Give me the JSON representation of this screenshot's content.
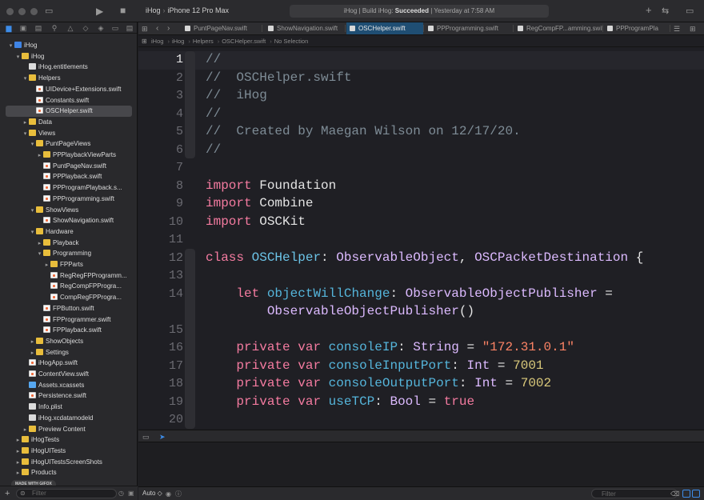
{
  "toolbar": {
    "scheme": "iHog",
    "destination": "iPhone 12 Pro Max",
    "status_prefix": "iHog | Build iHog: ",
    "status_result": "Succeeded",
    "status_suffix": " | Yesterday at 7:58 AM"
  },
  "tabs": [
    {
      "label": "PuntPageNav.swift",
      "active": false
    },
    {
      "label": "ShowNavigation.swift",
      "active": false
    },
    {
      "label": "OSCHelper.swift",
      "active": true
    },
    {
      "label": "PPProgramming.swift",
      "active": false
    },
    {
      "label": "RegCompFP...amming.swift",
      "active": false
    },
    {
      "label": "PPProgramPla",
      "active": false
    }
  ],
  "breadcrumbs": [
    "iHog",
    "iHog",
    "Helpers",
    "OSCHelper.swift",
    "No Selection"
  ],
  "navigator": {
    "items": [
      {
        "label": "iHog",
        "icon": "proj",
        "depth": 0,
        "disc": "▾"
      },
      {
        "label": "iHog",
        "icon": "folder",
        "depth": 1,
        "disc": "▾"
      },
      {
        "label": "iHog.entitlements",
        "icon": "file",
        "depth": 2,
        "disc": ""
      },
      {
        "label": "Helpers",
        "icon": "folder",
        "depth": 2,
        "disc": "▾"
      },
      {
        "label": "UIDevice+Extensions.swift",
        "icon": "swift",
        "depth": 3,
        "disc": ""
      },
      {
        "label": "Constants.swift",
        "icon": "swift",
        "depth": 3,
        "disc": ""
      },
      {
        "label": "OSCHelper.swift",
        "icon": "swift",
        "depth": 3,
        "disc": "",
        "selected": true
      },
      {
        "label": "Data",
        "icon": "folder",
        "depth": 2,
        "disc": "▸"
      },
      {
        "label": "Views",
        "icon": "folder",
        "depth": 2,
        "disc": "▾"
      },
      {
        "label": "PuntPageViews",
        "icon": "folder",
        "depth": 3,
        "disc": "▾"
      },
      {
        "label": "PPPlaybackViewParts",
        "icon": "folder",
        "depth": 4,
        "disc": "▸"
      },
      {
        "label": "PuntPageNav.swift",
        "icon": "swift",
        "depth": 4,
        "disc": ""
      },
      {
        "label": "PPPlayback.swift",
        "icon": "swift",
        "depth": 4,
        "disc": ""
      },
      {
        "label": "PPProgramPlayback.s...",
        "icon": "swift",
        "depth": 4,
        "disc": ""
      },
      {
        "label": "PPProgramming.swift",
        "icon": "swift",
        "depth": 4,
        "disc": ""
      },
      {
        "label": "ShowViews",
        "icon": "folder",
        "depth": 3,
        "disc": "▾"
      },
      {
        "label": "ShowNavigation.swift",
        "icon": "swift",
        "depth": 4,
        "disc": ""
      },
      {
        "label": "Hardware",
        "icon": "folder",
        "depth": 3,
        "disc": "▾"
      },
      {
        "label": "Playback",
        "icon": "folder",
        "depth": 4,
        "disc": "▸"
      },
      {
        "label": "Programming",
        "icon": "folder",
        "depth": 4,
        "disc": "▾"
      },
      {
        "label": "FPParts",
        "icon": "folder",
        "depth": 5,
        "disc": "▸"
      },
      {
        "label": "RegRegFPProgramm...",
        "icon": "swift",
        "depth": 5,
        "disc": ""
      },
      {
        "label": "RegCompFPProgra...",
        "icon": "swift",
        "depth": 5,
        "disc": ""
      },
      {
        "label": "CompRegFPProgra...",
        "icon": "swift",
        "depth": 5,
        "disc": ""
      },
      {
        "label": "FPButton.swift",
        "icon": "swift",
        "depth": 4,
        "disc": ""
      },
      {
        "label": "FPProgrammer.swift",
        "icon": "swift",
        "depth": 4,
        "disc": ""
      },
      {
        "label": "FPPlayback.swift",
        "icon": "swift",
        "depth": 4,
        "disc": ""
      },
      {
        "label": "ShowObjects",
        "icon": "folder",
        "depth": 3,
        "disc": "▸"
      },
      {
        "label": "Settings",
        "icon": "folder",
        "depth": 3,
        "disc": "▸"
      },
      {
        "label": "iHogApp.swift",
        "icon": "swift",
        "depth": 2,
        "disc": ""
      },
      {
        "label": "ContentView.swift",
        "icon": "swift",
        "depth": 2,
        "disc": ""
      },
      {
        "label": "Assets.xcassets",
        "icon": "assets",
        "depth": 2,
        "disc": ""
      },
      {
        "label": "Persistence.swift",
        "icon": "swift",
        "depth": 2,
        "disc": ""
      },
      {
        "label": "Info.plist",
        "icon": "file",
        "depth": 2,
        "disc": ""
      },
      {
        "label": "iHog.xcdatamodeld",
        "icon": "data",
        "depth": 2,
        "disc": ""
      },
      {
        "label": "Preview Content",
        "icon": "folder",
        "depth": 2,
        "disc": "▸"
      },
      {
        "label": "iHogTests",
        "icon": "folder",
        "depth": 1,
        "disc": "▸"
      },
      {
        "label": "iHogUITests",
        "icon": "folder",
        "depth": 1,
        "disc": "▸"
      },
      {
        "label": "iHogUITestsScreenShots",
        "icon": "folder",
        "depth": 1,
        "disc": "▸"
      },
      {
        "label": "Products",
        "icon": "folder",
        "depth": 1,
        "disc": "▸"
      }
    ],
    "filter_placeholder": "Filter",
    "watermark": "MADE WITH GIFOX"
  },
  "editor": {
    "current_line": 1,
    "lines": [
      {
        "num": "1",
        "tokens": [
          [
            "//",
            "c-comment"
          ]
        ]
      },
      {
        "num": "2",
        "tokens": [
          [
            "//  OSCHelper.swift",
            "c-comment"
          ]
        ]
      },
      {
        "num": "3",
        "tokens": [
          [
            "//  iHog",
            "c-comment"
          ]
        ]
      },
      {
        "num": "4",
        "tokens": [
          [
            "//",
            "c-comment"
          ]
        ]
      },
      {
        "num": "5",
        "tokens": [
          [
            "//  Created by Maegan Wilson on 12/17/20.",
            "c-comment"
          ]
        ]
      },
      {
        "num": "6",
        "tokens": [
          [
            "//",
            "c-comment"
          ]
        ]
      },
      {
        "num": "7",
        "tokens": []
      },
      {
        "num": "8",
        "tokens": [
          [
            "import",
            "c-kw"
          ],
          [
            " Foundation",
            "c-plain"
          ]
        ]
      },
      {
        "num": "9",
        "tokens": [
          [
            "import",
            "c-kw"
          ],
          [
            " Combine",
            "c-plain"
          ]
        ]
      },
      {
        "num": "10",
        "tokens": [
          [
            "import",
            "c-kw"
          ],
          [
            " OSCKit",
            "c-plain"
          ]
        ]
      },
      {
        "num": "11",
        "tokens": []
      },
      {
        "num": "12",
        "tokens": [
          [
            "class",
            "c-kw"
          ],
          [
            " ",
            "c-plain"
          ],
          [
            "OSCHelper",
            "c-def"
          ],
          [
            ": ",
            "c-plain"
          ],
          [
            "ObservableObject",
            "c-type"
          ],
          [
            ", ",
            "c-plain"
          ],
          [
            "OSCPacketDestination",
            "c-type"
          ],
          [
            " {",
            "c-plain"
          ]
        ]
      },
      {
        "num": "13",
        "tokens": []
      },
      {
        "num": "14",
        "tokens": [
          [
            "    ",
            "c-plain"
          ],
          [
            "let",
            "c-kw"
          ],
          [
            " ",
            "c-plain"
          ],
          [
            "objectWillChange",
            "c-prop"
          ],
          [
            ": ",
            "c-plain"
          ],
          [
            "ObservableObjectPublisher",
            "c-type"
          ],
          [
            " =",
            "c-plain"
          ]
        ]
      },
      {
        "num": "",
        "tokens": [
          [
            "        ",
            "c-plain"
          ],
          [
            "ObservableObjectPublisher",
            "c-type"
          ],
          [
            "()",
            "c-plain"
          ]
        ]
      },
      {
        "num": "15",
        "tokens": []
      },
      {
        "num": "16",
        "tokens": [
          [
            "    ",
            "c-plain"
          ],
          [
            "private",
            "c-kw"
          ],
          [
            " ",
            "c-plain"
          ],
          [
            "var",
            "c-kw"
          ],
          [
            " ",
            "c-plain"
          ],
          [
            "consoleIP",
            "c-prop"
          ],
          [
            ": ",
            "c-plain"
          ],
          [
            "String",
            "c-type"
          ],
          [
            " = ",
            "c-plain"
          ],
          [
            "\"172.31.0.1\"",
            "c-str"
          ]
        ]
      },
      {
        "num": "17",
        "tokens": [
          [
            "    ",
            "c-plain"
          ],
          [
            "private",
            "c-kw"
          ],
          [
            " ",
            "c-plain"
          ],
          [
            "var",
            "c-kw"
          ],
          [
            " ",
            "c-plain"
          ],
          [
            "consoleInputPort",
            "c-prop"
          ],
          [
            ": ",
            "c-plain"
          ],
          [
            "Int",
            "c-type"
          ],
          [
            " = ",
            "c-plain"
          ],
          [
            "7001",
            "c-num"
          ]
        ]
      },
      {
        "num": "18",
        "tokens": [
          [
            "    ",
            "c-plain"
          ],
          [
            "private",
            "c-kw"
          ],
          [
            " ",
            "c-plain"
          ],
          [
            "var",
            "c-kw"
          ],
          [
            " ",
            "c-plain"
          ],
          [
            "consoleOutputPort",
            "c-prop"
          ],
          [
            ": ",
            "c-plain"
          ],
          [
            "Int",
            "c-type"
          ],
          [
            " = ",
            "c-plain"
          ],
          [
            "7002",
            "c-num"
          ]
        ]
      },
      {
        "num": "19",
        "tokens": [
          [
            "    ",
            "c-plain"
          ],
          [
            "private",
            "c-kw"
          ],
          [
            " ",
            "c-plain"
          ],
          [
            "var",
            "c-kw"
          ],
          [
            " ",
            "c-plain"
          ],
          [
            "useTCP",
            "c-prop"
          ],
          [
            ": ",
            "c-plain"
          ],
          [
            "Bool",
            "c-type"
          ],
          [
            " = ",
            "c-plain"
          ],
          [
            "true",
            "c-kw"
          ]
        ]
      },
      {
        "num": "20",
        "tokens": []
      }
    ]
  },
  "debug": {
    "auto_label": "Auto ◇",
    "filter_placeholder": "Filter"
  },
  "colors": {
    "accent": "#3d8ce8",
    "keyword": "#f47ba0",
    "type": "#dcbaff",
    "string": "#fc8365",
    "number": "#dac97b",
    "comment": "#7e8c96"
  }
}
